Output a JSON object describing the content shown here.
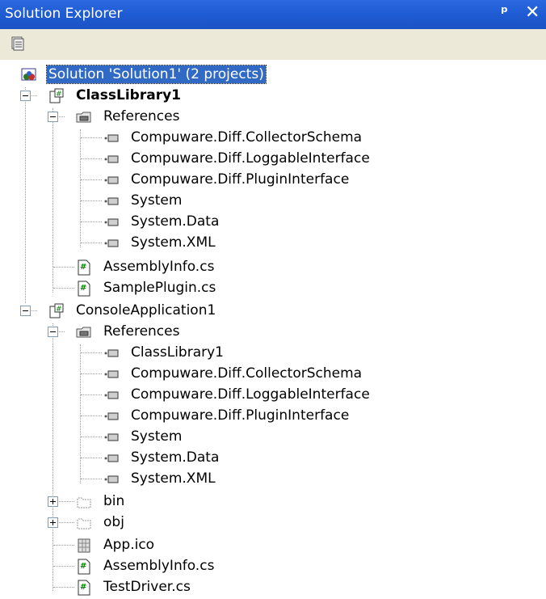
{
  "window": {
    "title": "Solution Explorer",
    "pin_glyph": "ᵖ",
    "close_glyph": "✕"
  },
  "toolbar": {
    "properties_icon": "properties-icon"
  },
  "tree": {
    "solution": "Solution 'Solution1' (2 projects)",
    "project1": {
      "label": "ClassLibrary1",
      "references_label": "References",
      "references": [
        "Compuware.Diff.CollectorSchema",
        "Compuware.Diff.LoggableInterface",
        "Compuware.Diff.PluginInterface",
        "System",
        "System.Data",
        "System.XML"
      ],
      "files": [
        "AssemblyInfo.cs",
        "SamplePlugin.cs"
      ]
    },
    "project2": {
      "label": "ConsoleApplication1",
      "references_label": "References",
      "references": [
        "ClassLibrary1",
        "Compuware.Diff.CollectorSchema",
        "Compuware.Diff.LoggableInterface",
        "Compuware.Diff.PluginInterface",
        "System",
        "System.Data",
        "System.XML"
      ],
      "folders": [
        "bin",
        "obj"
      ],
      "files": [
        "App.ico",
        "AssemblyInfo.cs",
        "TestDriver.cs"
      ]
    }
  }
}
